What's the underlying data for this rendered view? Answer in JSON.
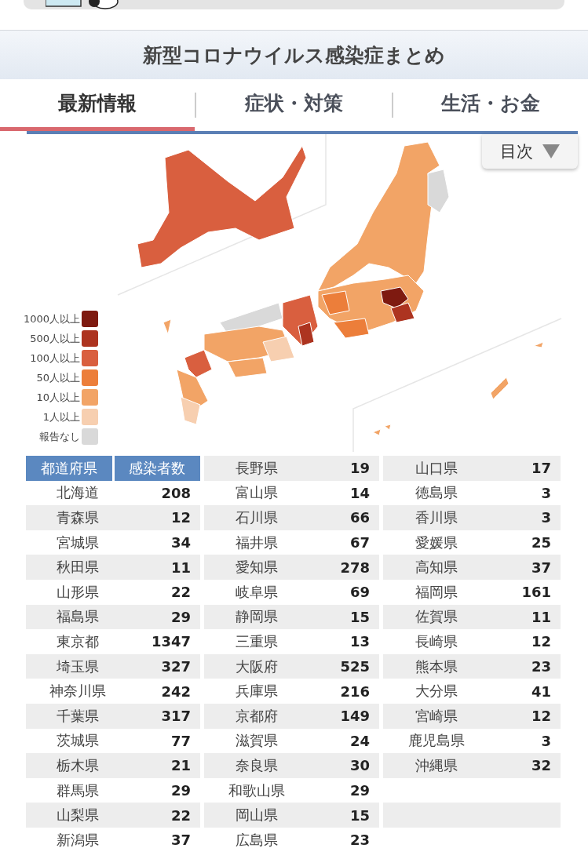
{
  "header": {
    "title": "新型コロナウイルス感染症まとめ"
  },
  "tabs": [
    {
      "label": "最新情報",
      "selected": true
    },
    {
      "label": "症状・対策",
      "selected": false
    },
    {
      "label": "生活・お金",
      "selected": false
    }
  ],
  "toc_button": {
    "label": "目次"
  },
  "legend": [
    {
      "label": "1000人以上",
      "color": "#7e1a10"
    },
    {
      "label": "500人以上",
      "color": "#ad3420"
    },
    {
      "label": "100人以上",
      "color": "#d95f3f"
    },
    {
      "label": "50人以上",
      "color": "#ec7e3a"
    },
    {
      "label": "10人以上",
      "color": "#f2a466"
    },
    {
      "label": "1人以上",
      "color": "#f7cfb0"
    },
    {
      "label": "報告なし",
      "color": "#d9d9d9"
    }
  ],
  "table": {
    "columns": [
      "都道府県",
      "感染者数"
    ],
    "groups": [
      [
        {
          "name": "北海道",
          "count": "208"
        },
        {
          "name": "青森県",
          "count": "12"
        },
        {
          "name": "宮城県",
          "count": "34"
        },
        {
          "name": "秋田県",
          "count": "11"
        },
        {
          "name": "山形県",
          "count": "22"
        },
        {
          "name": "福島県",
          "count": "29"
        },
        {
          "name": "東京都",
          "count": "1347"
        },
        {
          "name": "埼玉県",
          "count": "327"
        },
        {
          "name": "神奈川県",
          "count": "242"
        },
        {
          "name": "千葉県",
          "count": "317"
        },
        {
          "name": "茨城県",
          "count": "77"
        },
        {
          "name": "栃木県",
          "count": "21"
        },
        {
          "name": "群馬県",
          "count": "29"
        },
        {
          "name": "山梨県",
          "count": "22"
        },
        {
          "name": "新潟県",
          "count": "37"
        }
      ],
      [
        {
          "name": "長野県",
          "count": "19"
        },
        {
          "name": "富山県",
          "count": "14"
        },
        {
          "name": "石川県",
          "count": "66"
        },
        {
          "name": "福井県",
          "count": "67"
        },
        {
          "name": "愛知県",
          "count": "278"
        },
        {
          "name": "岐阜県",
          "count": "69"
        },
        {
          "name": "静岡県",
          "count": "15"
        },
        {
          "name": "三重県",
          "count": "13"
        },
        {
          "name": "大阪府",
          "count": "525"
        },
        {
          "name": "兵庫県",
          "count": "216"
        },
        {
          "name": "京都府",
          "count": "149"
        },
        {
          "name": "滋賀県",
          "count": "24"
        },
        {
          "name": "奈良県",
          "count": "30"
        },
        {
          "name": "和歌山県",
          "count": "29"
        },
        {
          "name": "岡山県",
          "count": "15"
        },
        {
          "name": "広島県",
          "count": "23"
        }
      ],
      [
        {
          "name": "山口県",
          "count": "17"
        },
        {
          "name": "徳島県",
          "count": "3"
        },
        {
          "name": "香川県",
          "count": "3"
        },
        {
          "name": "愛媛県",
          "count": "25"
        },
        {
          "name": "高知県",
          "count": "37"
        },
        {
          "name": "福岡県",
          "count": "161"
        },
        {
          "name": "佐賀県",
          "count": "11"
        },
        {
          "name": "長崎県",
          "count": "12"
        },
        {
          "name": "熊本県",
          "count": "23"
        },
        {
          "name": "大分県",
          "count": "41"
        },
        {
          "name": "宮崎県",
          "count": "12"
        },
        {
          "name": "鹿児島県",
          "count": "3"
        },
        {
          "name": "沖縄県",
          "count": "32"
        }
      ]
    ]
  }
}
